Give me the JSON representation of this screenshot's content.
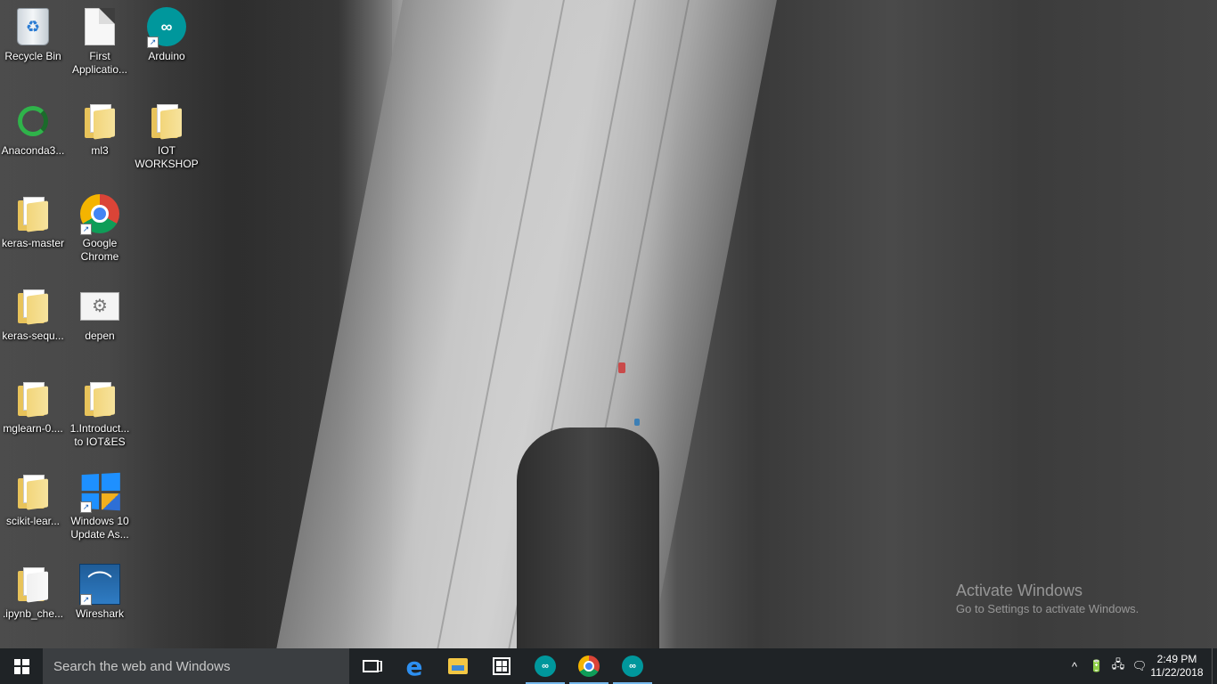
{
  "desktop": {
    "icons": [
      {
        "label": "Recycle Bin",
        "icon": "recycle-bin-icon"
      },
      {
        "label": "First Applicatio...",
        "icon": "document-icon"
      },
      {
        "label": "Arduino",
        "icon": "arduino-icon"
      },
      {
        "label": "Anaconda3...",
        "icon": "anaconda-icon"
      },
      {
        "label": "ml3",
        "icon": "folder-icon"
      },
      {
        "label": "IOT WORKSHOP",
        "icon": "folder-icon"
      },
      {
        "label": "keras-master",
        "icon": "folder-icon"
      },
      {
        "label": "Google Chrome",
        "icon": "chrome-icon"
      },
      {
        "label": "keras-sequ...",
        "icon": "folder-icon"
      },
      {
        "label": "depen",
        "icon": "settings-file-icon"
      },
      {
        "label": "mglearn-0....",
        "icon": "folder-icon"
      },
      {
        "label": "1.Introduct... to IOT&ES",
        "icon": "folder-icon"
      },
      {
        "label": "scikit-lear...",
        "icon": "folder-icon"
      },
      {
        "label": "Windows 10 Update As...",
        "icon": "windows-update-icon"
      },
      {
        "label": ".ipynb_che...",
        "icon": "folder-icon"
      },
      {
        "label": "Wireshark",
        "icon": "wireshark-icon"
      }
    ]
  },
  "watermark": {
    "title": "Activate Windows",
    "subtitle": "Go to Settings to activate Windows."
  },
  "taskbar": {
    "search_placeholder": "Search the web and Windows",
    "pinned": [
      {
        "name": "task-view",
        "icon": "task-view-icon"
      },
      {
        "name": "edge",
        "icon": "edge-icon",
        "glyph": "e"
      },
      {
        "name": "file-explorer",
        "icon": "folder-icon"
      },
      {
        "name": "store",
        "icon": "store-icon"
      },
      {
        "name": "arduino",
        "icon": "arduino-icon",
        "active": true
      },
      {
        "name": "chrome",
        "icon": "chrome-icon",
        "active": true
      },
      {
        "name": "arduino-2",
        "icon": "arduino-icon",
        "active": true
      }
    ],
    "tray": {
      "chevron": "^",
      "battery": "🔋",
      "network": "🖧",
      "notifications": "🗨"
    },
    "clock": {
      "time": "2:49 PM",
      "date": "11/22/2018"
    }
  },
  "colors": {
    "taskbar": "#1f2326",
    "search_box": "#3b3e41",
    "active_indicator": "#76b9ed",
    "arduino": "#00979c"
  }
}
